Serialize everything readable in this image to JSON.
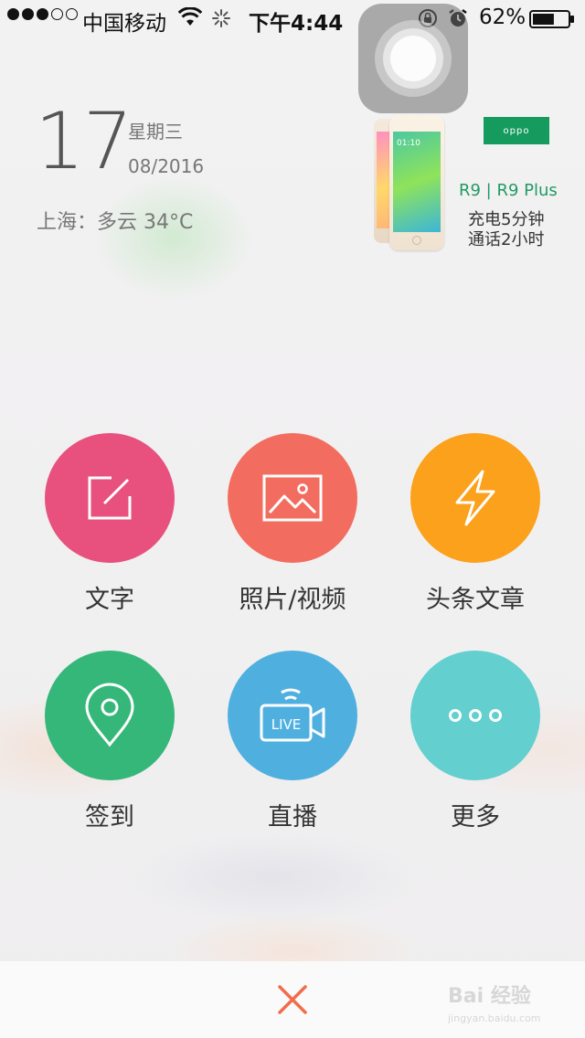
{
  "status_bar": {
    "carrier": "中国移动",
    "time": "下午4:44",
    "battery": "62%",
    "signal_bars_filled": 3,
    "signal_bars_total": 5,
    "battery_level": 0.62
  },
  "date": {
    "day": "17",
    "weekday": "星期三",
    "month_year": "08/2016"
  },
  "weather": {
    "text": "上海：多云 34°C"
  },
  "ad": {
    "brand": "oppo",
    "model": "R9 | R9 Plus",
    "line1": "充电5分钟",
    "line2": "通话2小时",
    "screen_time": "01:10",
    "brand_color": "#159b5e"
  },
  "actions": [
    {
      "label": "文字",
      "color": "#e8507e",
      "icon": "edit-icon"
    },
    {
      "label": "照片/视频",
      "color": "#f26d5f",
      "icon": "image-icon"
    },
    {
      "label": "头条文章",
      "color": "#fba11b",
      "icon": "lightning-icon"
    },
    {
      "label": "签到",
      "color": "#36b77a",
      "icon": "location-pin-icon"
    },
    {
      "label": "直播",
      "color": "#4fb0e0",
      "icon": "live-camera-icon",
      "badge": "LIVE"
    },
    {
      "label": "更多",
      "color": "#63cfcf",
      "icon": "more-dots-icon"
    }
  ],
  "bottom_bar": {
    "close_color": "#f26d4b"
  },
  "watermark": {
    "main": "Bai 经验",
    "sub": "jingyan.baidu.com"
  }
}
